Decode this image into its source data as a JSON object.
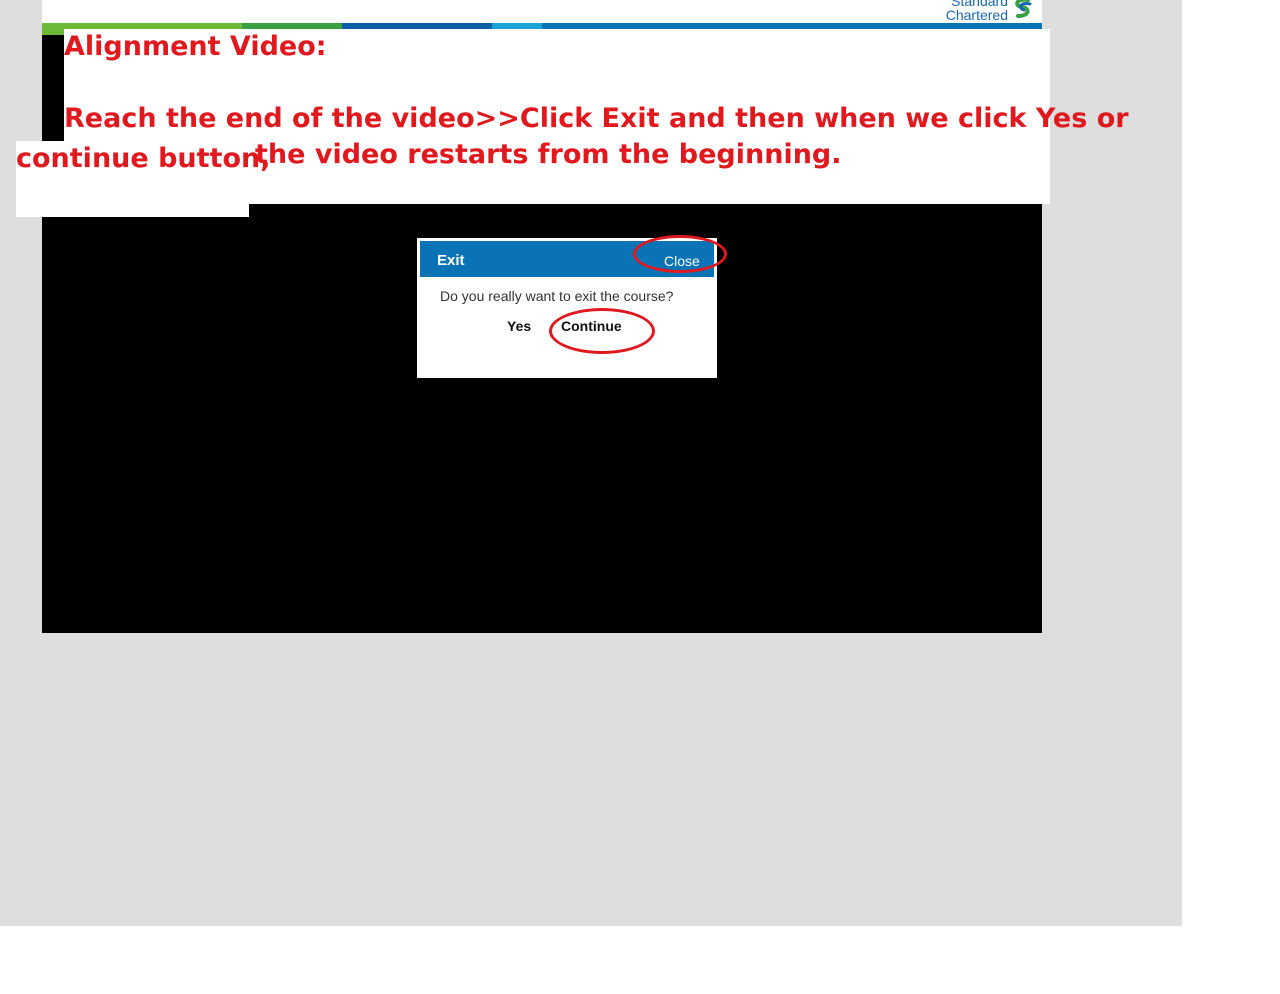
{
  "brand": {
    "line1": "Standard",
    "line2": "Chartered",
    "colors": [
      "#6cba38",
      "#3aa142",
      "#0b5ea8",
      "#1a4f8e",
      "#1aa3d6",
      "#0a73b5"
    ]
  },
  "annotation": {
    "title": "Alignment Video:",
    "line1": "Reach the end of the video>>Click Exit and then when we click Yes or",
    "line2a": "continue button,",
    "line2b": "the video restarts from the beginning.",
    "color": "#e0191f"
  },
  "dialog": {
    "title": "Exit",
    "close_label": "Close",
    "message": "Do you really want to exit the course?",
    "yes_label": "Yes",
    "continue_label": "Continue",
    "header_color": "#0a73b5"
  }
}
